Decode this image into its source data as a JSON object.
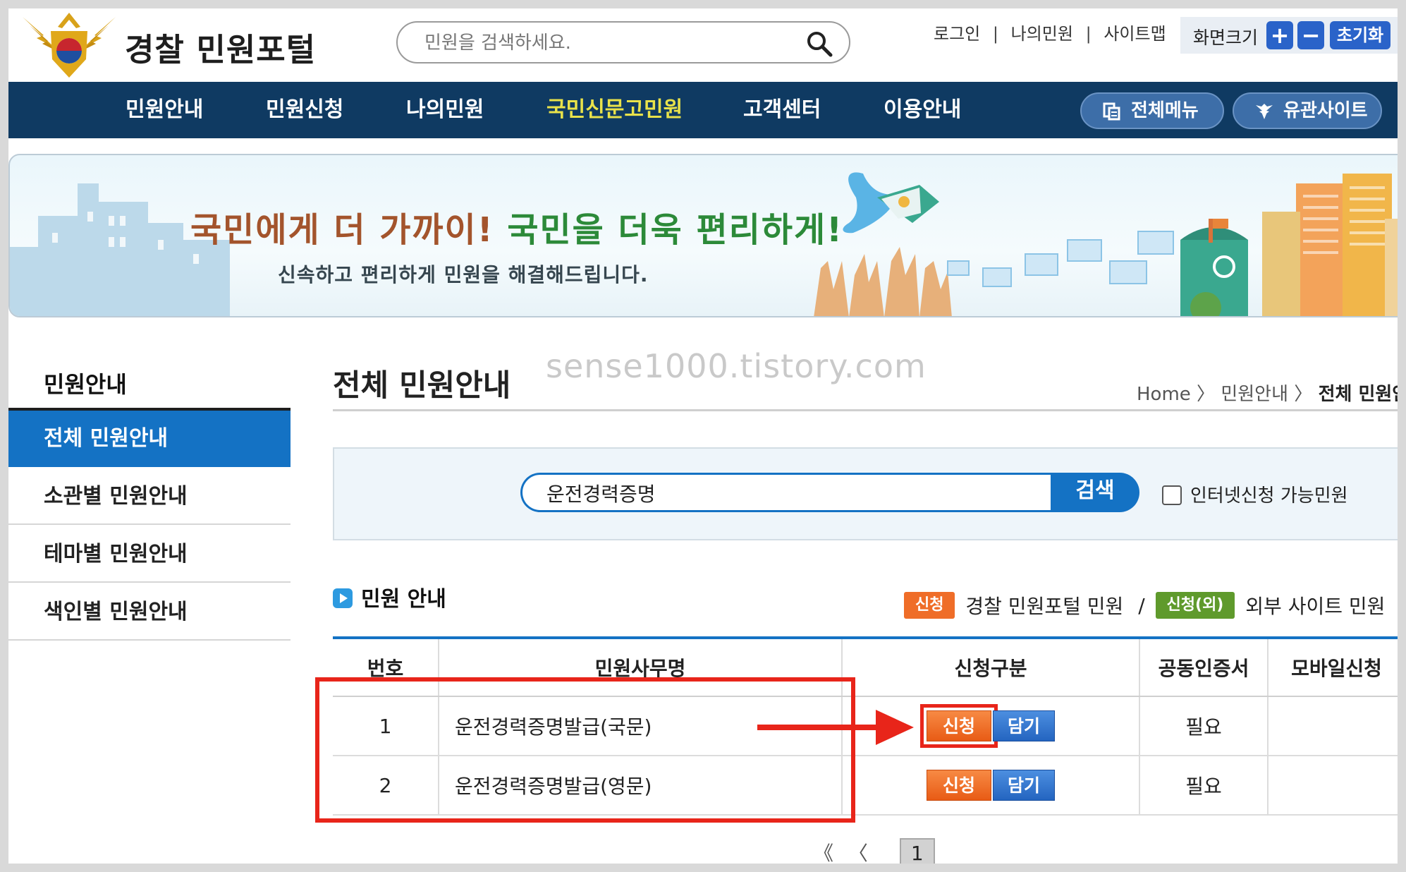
{
  "header": {
    "site_title": "경찰 민원포털",
    "search_placeholder": "민원을 검색하세요.",
    "util_links": [
      "로그인",
      "나의민원",
      "사이트맵"
    ],
    "util_sep": "|",
    "zoom_label": "화면크기",
    "zoom_plus": "+",
    "zoom_minus": "−",
    "zoom_reset": "초기화"
  },
  "nav": {
    "items": [
      "민원안내",
      "민원신청",
      "나의민원",
      "국민신문고민원",
      "고객센터",
      "이용안내"
    ],
    "active_index": 3,
    "all_menu": "전체메뉴",
    "related_sites": "유관사이트"
  },
  "banner": {
    "headline_part1": "국민에게 더 가까이!",
    "headline_part2": "국민을 더욱 편리하게!",
    "subline": "신속하고 편리하게 민원을 해결해드립니다."
  },
  "sidebar": {
    "title": "민원안내",
    "items": [
      {
        "label": "전체 민원안내",
        "active": true
      },
      {
        "label": "소관별 민원안내",
        "active": false
      },
      {
        "label": "테마별 민원안내",
        "active": false
      },
      {
        "label": "색인별 민원안내",
        "active": false
      }
    ]
  },
  "content": {
    "title": "전체 민원안내",
    "watermark": "sense1000.tistory.com",
    "breadcrumb": {
      "home": "Home",
      "sep": "〉",
      "level1": "민원안내",
      "current": "전체 민원안내"
    }
  },
  "search": {
    "value": "운전경력증명",
    "button": "검색",
    "checkbox_label": "인터넷신청 가능민원"
  },
  "section": {
    "title": "민원 안내",
    "legend": {
      "internal_badge": "신청",
      "internal_text": "경찰 민원포털 민원",
      "divider": "/",
      "external_badge": "신청(외)",
      "external_text": "외부 사이트 민원"
    }
  },
  "table": {
    "headers": [
      "번호",
      "민원사무명",
      "신청구분",
      "공동인증서",
      "모바일신청"
    ],
    "rows": [
      {
        "no": "1",
        "name": "운전경력증명발급(국문)",
        "apply": "신청",
        "cart": "담기",
        "cert": "필요",
        "mobile": ""
      },
      {
        "no": "2",
        "name": "운전경력증명발급(영문)",
        "apply": "신청",
        "cart": "담기",
        "cert": "필요",
        "mobile": ""
      }
    ]
  },
  "pagination": {
    "first": "《",
    "prev": "〈",
    "current": "1"
  },
  "colors": {
    "nav_bg": "#0f3a62",
    "nav_active": "#e9e24a",
    "accent_blue": "#1472c4",
    "apply_orange": "#ef6d28",
    "external_green": "#5f9a2c",
    "annotation_red": "#e8251a"
  }
}
